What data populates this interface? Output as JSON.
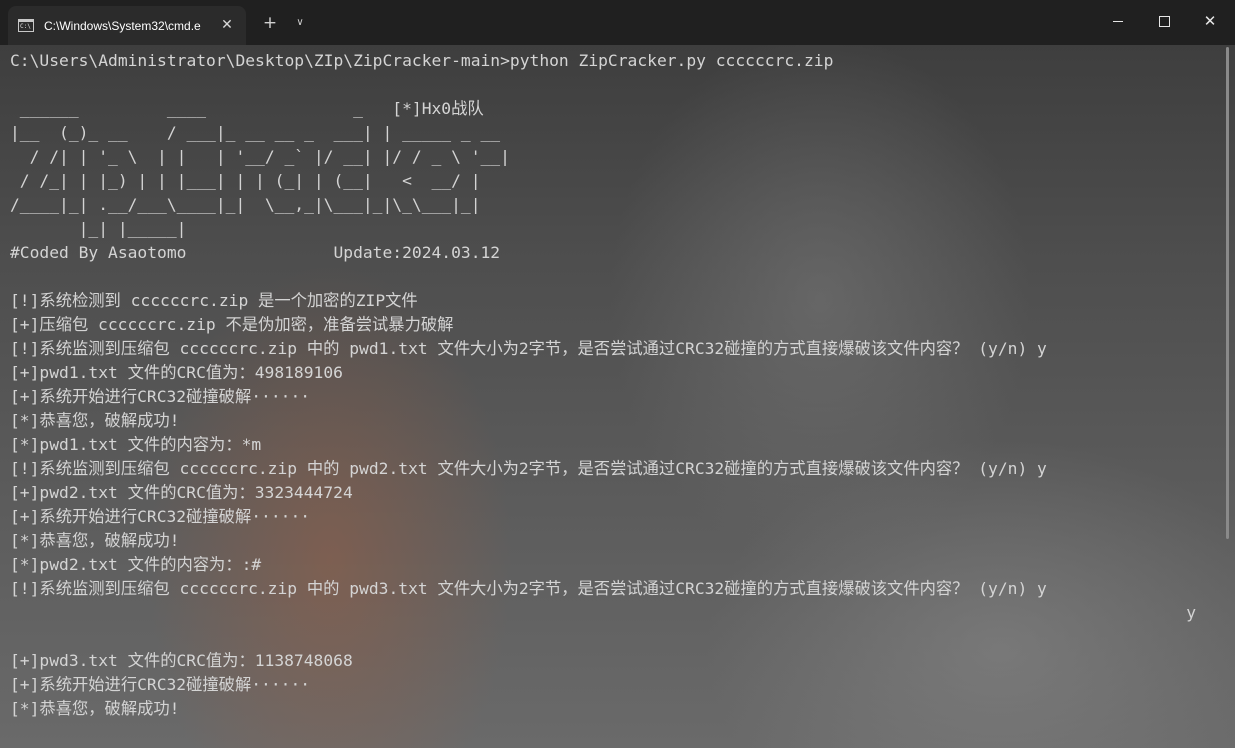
{
  "window": {
    "tab_title": "C:\\Windows\\System32\\cmd.e",
    "tab_icon_text": "C:\\",
    "tab_close": "✕",
    "new_tab": "+",
    "dropdown": "∨",
    "close_glyph": "✕"
  },
  "terminal": {
    "lines": [
      "C:\\Users\\Administrator\\Desktop\\ZIp\\ZipCracker-main>python ZipCracker.py ccccccrc.zip",
      "",
      " ______         ____               _   [*]Hx0战队",
      "|__  (_)_ __    / ___|_ __ __ _  ___| | _____ _ __",
      "  / /| | '_ \\  | |   | '__/ _` |/ __| |/ / _ \\ '__|",
      " / /_| | |_) | | |___| | | (_| | (__|   <  __/ |",
      "/____|_| .__/___\\____|_|  \\__,_|\\___|_|\\_\\___|_|",
      "       |_| |_____|",
      "#Coded By Asaotomo               Update:2024.03.12",
      "",
      "[!]系统检测到 ccccccrc.zip 是一个加密的ZIP文件",
      "[+]压缩包 ccccccrc.zip 不是伪加密，准备尝试暴力破解",
      "[!]系统监测到压缩包 ccccccrc.zip 中的 pwd1.txt 文件大小为2字节，是否尝试通过CRC32碰撞的方式直接爆破该文件内容？ (y/n) y",
      "[+]pwd1.txt 文件的CRC值为：498189106",
      "[+]系统开始进行CRC32碰撞破解······",
      "[*]恭喜您，破解成功!",
      "[*]pwd1.txt 文件的内容为：*m",
      "[!]系统监测到压缩包 ccccccrc.zip 中的 pwd2.txt 文件大小为2字节，是否尝试通过CRC32碰撞的方式直接爆破该文件内容？ (y/n) y",
      "[+]pwd2.txt 文件的CRC值为：3323444724",
      "[+]系统开始进行CRC32碰撞破解······",
      "[*]恭喜您，破解成功!",
      "[*]pwd2.txt 文件的内容为：:#",
      "[!]系统监测到压缩包 ccccccrc.zip 中的 pwd3.txt 文件大小为2字节，是否尝试通过CRC32碰撞的方式直接爆破该文件内容？ (y/n) y",
      "                                                                                                                        y",
      "",
      "[+]pwd3.txt 文件的CRC值为：1138748068",
      "[+]系统开始进行CRC32碰撞破解······",
      "[*]恭喜您，破解成功!"
    ]
  }
}
